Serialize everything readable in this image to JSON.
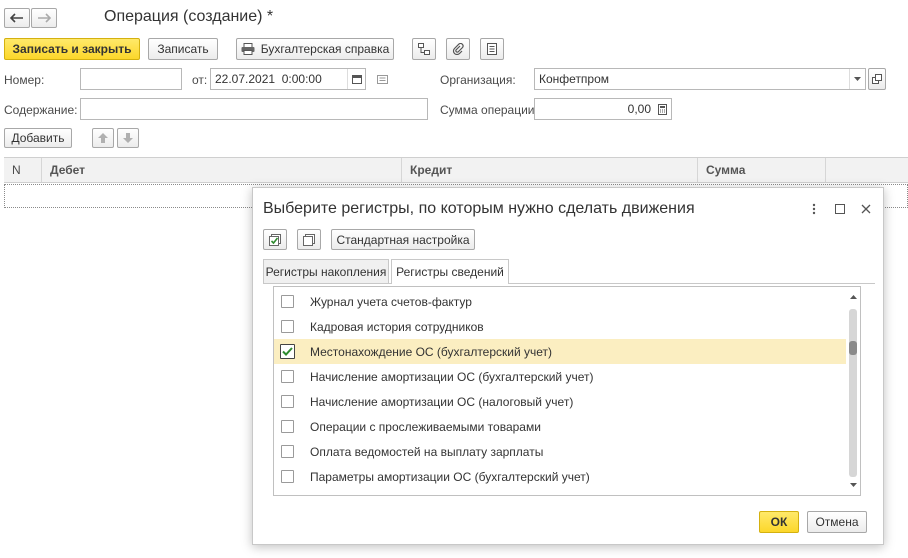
{
  "header": {
    "title": "Операция (создание) *"
  },
  "toolbar": {
    "save_close_label": "Записать и закрыть",
    "save_label": "Записать",
    "report_label": "Бухгалтерская справка"
  },
  "form": {
    "number_label": "Номер:",
    "number_value": "",
    "date_label": "от:",
    "date_value": "22.07.2021  0:00:00",
    "org_label": "Организация:",
    "org_value": "Конфетпром",
    "content_label": "Содержание:",
    "content_value": "",
    "sum_label": "Сумма операции:",
    "sum_value": "0,00"
  },
  "table_toolbar": {
    "add_label": "Добавить"
  },
  "table": {
    "columns": [
      "N",
      "Дебет",
      "Кредит",
      "Сумма"
    ]
  },
  "dialog": {
    "title": "Выберите регистры, по которым нужно сделать движения",
    "standard_settings_label": "Стандартная настройка",
    "tabs": [
      {
        "label": "Регистры накопления",
        "active": false
      },
      {
        "label": "Регистры сведений",
        "active": true
      }
    ],
    "items": [
      {
        "label": "Журнал учета счетов-фактур",
        "checked": false
      },
      {
        "label": "Кадровая история сотрудников",
        "checked": false
      },
      {
        "label": "Местонахождение ОС (бухгалтерский учет)",
        "checked": true
      },
      {
        "label": "Начисление амортизации ОС (бухгалтерский учет)",
        "checked": false
      },
      {
        "label": "Начисление амортизации ОС (налоговый учет)",
        "checked": false
      },
      {
        "label": "Операции с прослеживаемыми товарами",
        "checked": false
      },
      {
        "label": "Оплата ведомостей на выплату зарплаты",
        "checked": false
      },
      {
        "label": "Параметры амортизации ОС (бухгалтерский учет)",
        "checked": false
      }
    ],
    "ok_label": "ОК",
    "cancel_label": "Отмена"
  },
  "colors": {
    "accent_yellow": "#fcd72a",
    "selected_row": "#fbeec1",
    "check_green": "#2e8b2e"
  }
}
